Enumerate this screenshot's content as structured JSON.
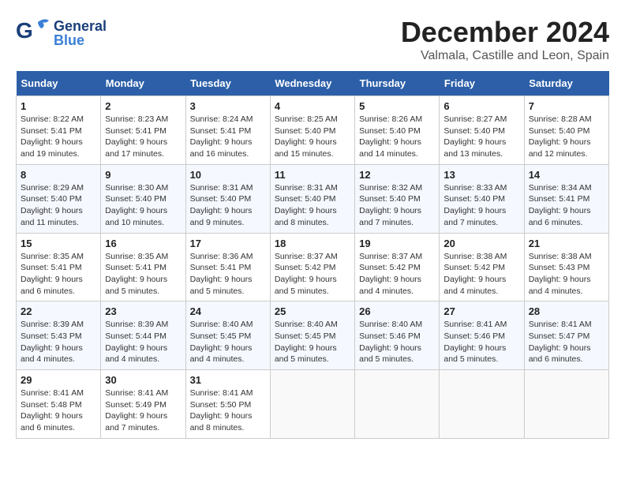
{
  "header": {
    "logo_general": "General",
    "logo_blue": "Blue",
    "month": "December 2024",
    "location": "Valmala, Castille and Leon, Spain"
  },
  "weekdays": [
    "Sunday",
    "Monday",
    "Tuesday",
    "Wednesday",
    "Thursday",
    "Friday",
    "Saturday"
  ],
  "weeks": [
    [
      {
        "day": "1",
        "sunrise": "Sunrise: 8:22 AM",
        "sunset": "Sunset: 5:41 PM",
        "daylight": "Daylight: 9 hours and 19 minutes."
      },
      {
        "day": "2",
        "sunrise": "Sunrise: 8:23 AM",
        "sunset": "Sunset: 5:41 PM",
        "daylight": "Daylight: 9 hours and 17 minutes."
      },
      {
        "day": "3",
        "sunrise": "Sunrise: 8:24 AM",
        "sunset": "Sunset: 5:41 PM",
        "daylight": "Daylight: 9 hours and 16 minutes."
      },
      {
        "day": "4",
        "sunrise": "Sunrise: 8:25 AM",
        "sunset": "Sunset: 5:40 PM",
        "daylight": "Daylight: 9 hours and 15 minutes."
      },
      {
        "day": "5",
        "sunrise": "Sunrise: 8:26 AM",
        "sunset": "Sunset: 5:40 PM",
        "daylight": "Daylight: 9 hours and 14 minutes."
      },
      {
        "day": "6",
        "sunrise": "Sunrise: 8:27 AM",
        "sunset": "Sunset: 5:40 PM",
        "daylight": "Daylight: 9 hours and 13 minutes."
      },
      {
        "day": "7",
        "sunrise": "Sunrise: 8:28 AM",
        "sunset": "Sunset: 5:40 PM",
        "daylight": "Daylight: 9 hours and 12 minutes."
      }
    ],
    [
      {
        "day": "8",
        "sunrise": "Sunrise: 8:29 AM",
        "sunset": "Sunset: 5:40 PM",
        "daylight": "Daylight: 9 hours and 11 minutes."
      },
      {
        "day": "9",
        "sunrise": "Sunrise: 8:30 AM",
        "sunset": "Sunset: 5:40 PM",
        "daylight": "Daylight: 9 hours and 10 minutes."
      },
      {
        "day": "10",
        "sunrise": "Sunrise: 8:31 AM",
        "sunset": "Sunset: 5:40 PM",
        "daylight": "Daylight: 9 hours and 9 minutes."
      },
      {
        "day": "11",
        "sunrise": "Sunrise: 8:31 AM",
        "sunset": "Sunset: 5:40 PM",
        "daylight": "Daylight: 9 hours and 8 minutes."
      },
      {
        "day": "12",
        "sunrise": "Sunrise: 8:32 AM",
        "sunset": "Sunset: 5:40 PM",
        "daylight": "Daylight: 9 hours and 7 minutes."
      },
      {
        "day": "13",
        "sunrise": "Sunrise: 8:33 AM",
        "sunset": "Sunset: 5:40 PM",
        "daylight": "Daylight: 9 hours and 7 minutes."
      },
      {
        "day": "14",
        "sunrise": "Sunrise: 8:34 AM",
        "sunset": "Sunset: 5:41 PM",
        "daylight": "Daylight: 9 hours and 6 minutes."
      }
    ],
    [
      {
        "day": "15",
        "sunrise": "Sunrise: 8:35 AM",
        "sunset": "Sunset: 5:41 PM",
        "daylight": "Daylight: 9 hours and 6 minutes."
      },
      {
        "day": "16",
        "sunrise": "Sunrise: 8:35 AM",
        "sunset": "Sunset: 5:41 PM",
        "daylight": "Daylight: 9 hours and 5 minutes."
      },
      {
        "day": "17",
        "sunrise": "Sunrise: 8:36 AM",
        "sunset": "Sunset: 5:41 PM",
        "daylight": "Daylight: 9 hours and 5 minutes."
      },
      {
        "day": "18",
        "sunrise": "Sunrise: 8:37 AM",
        "sunset": "Sunset: 5:42 PM",
        "daylight": "Daylight: 9 hours and 5 minutes."
      },
      {
        "day": "19",
        "sunrise": "Sunrise: 8:37 AM",
        "sunset": "Sunset: 5:42 PM",
        "daylight": "Daylight: 9 hours and 4 minutes."
      },
      {
        "day": "20",
        "sunrise": "Sunrise: 8:38 AM",
        "sunset": "Sunset: 5:42 PM",
        "daylight": "Daylight: 9 hours and 4 minutes."
      },
      {
        "day": "21",
        "sunrise": "Sunrise: 8:38 AM",
        "sunset": "Sunset: 5:43 PM",
        "daylight": "Daylight: 9 hours and 4 minutes."
      }
    ],
    [
      {
        "day": "22",
        "sunrise": "Sunrise: 8:39 AM",
        "sunset": "Sunset: 5:43 PM",
        "daylight": "Daylight: 9 hours and 4 minutes."
      },
      {
        "day": "23",
        "sunrise": "Sunrise: 8:39 AM",
        "sunset": "Sunset: 5:44 PM",
        "daylight": "Daylight: 9 hours and 4 minutes."
      },
      {
        "day": "24",
        "sunrise": "Sunrise: 8:40 AM",
        "sunset": "Sunset: 5:45 PM",
        "daylight": "Daylight: 9 hours and 4 minutes."
      },
      {
        "day": "25",
        "sunrise": "Sunrise: 8:40 AM",
        "sunset": "Sunset: 5:45 PM",
        "daylight": "Daylight: 9 hours and 5 minutes."
      },
      {
        "day": "26",
        "sunrise": "Sunrise: 8:40 AM",
        "sunset": "Sunset: 5:46 PM",
        "daylight": "Daylight: 9 hours and 5 minutes."
      },
      {
        "day": "27",
        "sunrise": "Sunrise: 8:41 AM",
        "sunset": "Sunset: 5:46 PM",
        "daylight": "Daylight: 9 hours and 5 minutes."
      },
      {
        "day": "28",
        "sunrise": "Sunrise: 8:41 AM",
        "sunset": "Sunset: 5:47 PM",
        "daylight": "Daylight: 9 hours and 6 minutes."
      }
    ],
    [
      {
        "day": "29",
        "sunrise": "Sunrise: 8:41 AM",
        "sunset": "Sunset: 5:48 PM",
        "daylight": "Daylight: 9 hours and 6 minutes."
      },
      {
        "day": "30",
        "sunrise": "Sunrise: 8:41 AM",
        "sunset": "Sunset: 5:49 PM",
        "daylight": "Daylight: 9 hours and 7 minutes."
      },
      {
        "day": "31",
        "sunrise": "Sunrise: 8:41 AM",
        "sunset": "Sunset: 5:50 PM",
        "daylight": "Daylight: 9 hours and 8 minutes."
      },
      null,
      null,
      null,
      null
    ]
  ]
}
